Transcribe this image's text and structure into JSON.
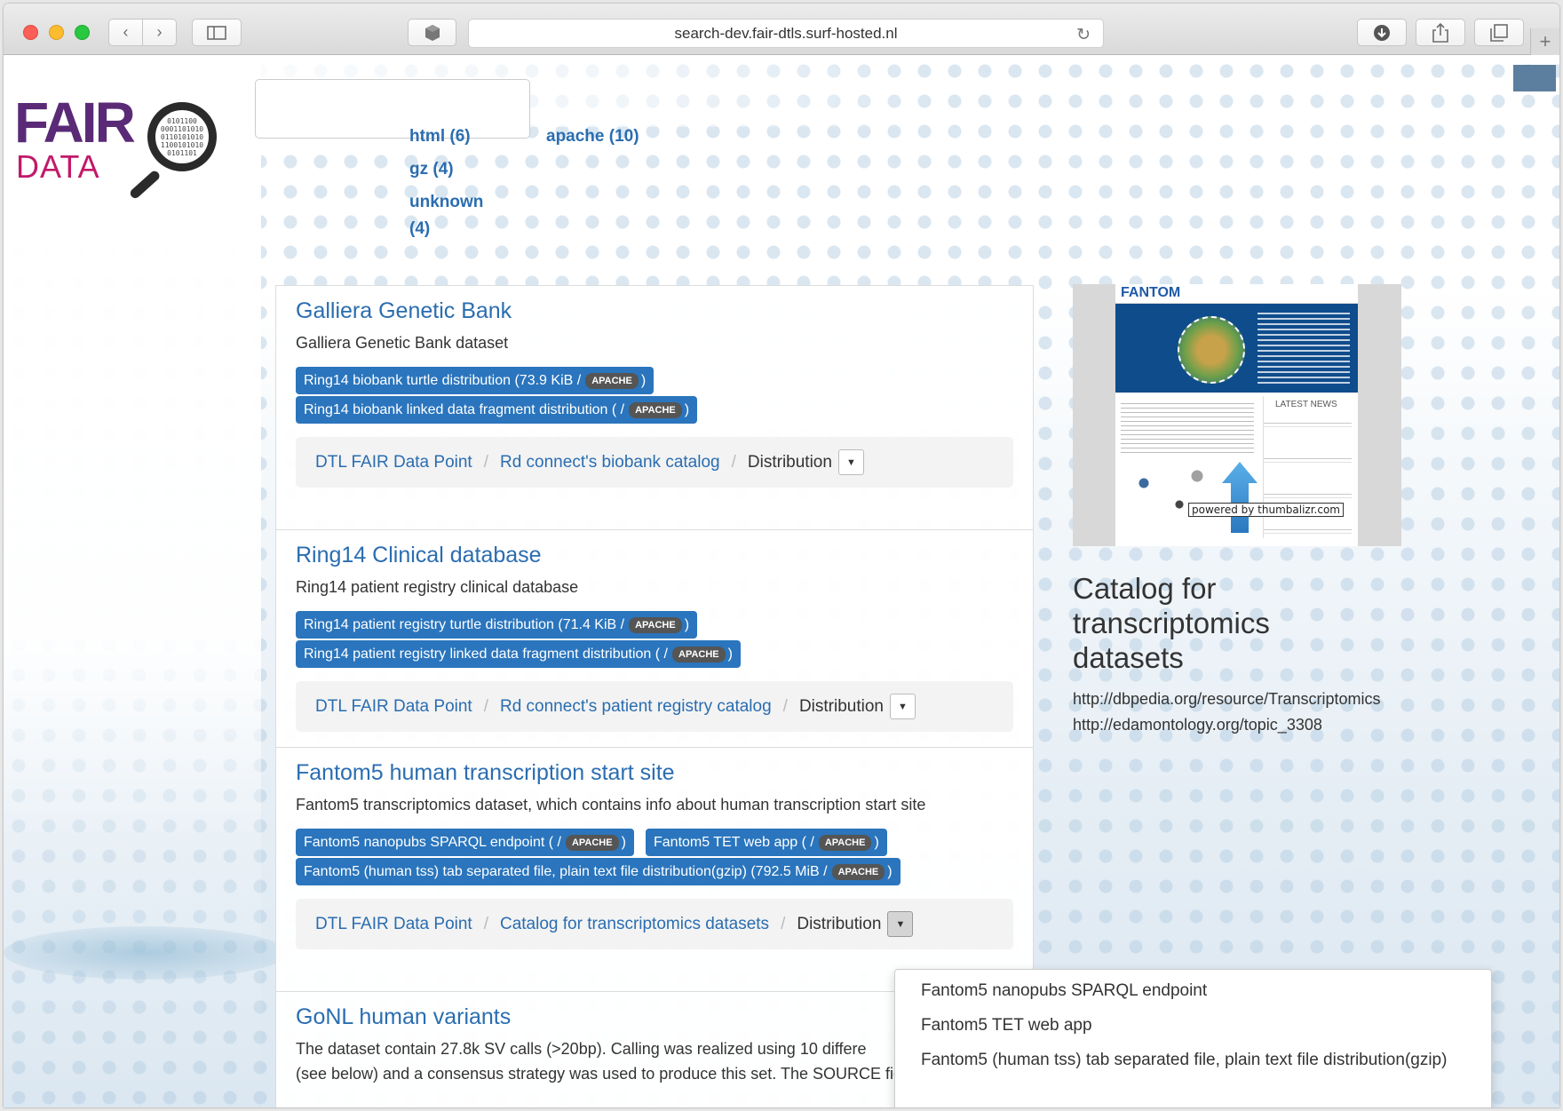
{
  "browser": {
    "url": "search-dev.fair-dtls.surf-hosted.nl"
  },
  "logo": {
    "fair": "FAIR",
    "data": "DATA",
    "lens_bits": "0101100\n0001101010\n0110101010\n1100101010\n0101101"
  },
  "search": {
    "value": "",
    "placeholder": ""
  },
  "facets": [
    {
      "label": "html (6)"
    },
    {
      "label": "apache (10)"
    },
    {
      "label": "gz (4)"
    },
    {
      "label": "unknown",
      "label2": "(4)"
    }
  ],
  "results": [
    {
      "title": "Galliera Genetic Bank",
      "description": "Galliera Genetic Bank dataset",
      "distributions": [
        {
          "label": "Ring14 biobank turtle distribution (73.9 KiB /",
          "license": "APACHE"
        },
        {
          "label": "Ring14 biobank linked data fragment distribution ( /",
          "license": "APACHE"
        }
      ],
      "breadcrumb": [
        "DTL FAIR Data Point",
        "Rd connect's biobank catalog",
        "Distribution"
      ]
    },
    {
      "title": "Ring14 Clinical database",
      "description": "Ring14 patient registry clinical database",
      "distributions": [
        {
          "label": "Ring14 patient registry turtle distribution (71.4 KiB /",
          "license": "APACHE"
        },
        {
          "label": "Ring14 patient registry linked data fragment distribution ( /",
          "license": "APACHE"
        }
      ],
      "breadcrumb": [
        "DTL FAIR Data Point",
        "Rd connect's patient registry catalog",
        "Distribution"
      ]
    },
    {
      "title": "Fantom5 human transcription start site",
      "description": "Fantom5 transcriptomics dataset, which contains info about human transcription start site",
      "distributions": [
        {
          "label": "Fantom5 nanopubs SPARQL endpoint ( /",
          "license": "APACHE"
        },
        {
          "label": "Fantom5 TET web app ( /",
          "license": "APACHE"
        },
        {
          "label": "Fantom5 (human tss) tab separated file, plain text file distribution(gzip) (792.5 MiB /",
          "license": "APACHE"
        }
      ],
      "breadcrumb": [
        "DTL FAIR Data Point",
        "Catalog for transcriptomics datasets",
        "Distribution"
      ]
    },
    {
      "title": "GoNL human variants",
      "description_line1": "The dataset contain 27.8k SV calls (>20bp). Calling was realized using 10 differe",
      "description_line2": "(see below) and a consensus strategy was used to produce this set. The SOURCE field in the"
    }
  ],
  "badge_close": ")",
  "dropdown": {
    "items": [
      "Fantom5 nanopubs SPARQL endpoint",
      "Fantom5 TET web app",
      "Fantom5 (human tss) tab separated file, plain text file distribution(gzip)"
    ]
  },
  "side_panel": {
    "preview_logo": "FANTOM",
    "preview_news": "LATEST NEWS",
    "powered_by": "powered by thumbalizr.com",
    "title": "Catalog for transcriptomics datasets",
    "uris": [
      "http://dbpedia.org/resource/Transcriptomics",
      "http://edamontology.org/topic_3308"
    ]
  },
  "colors": {
    "link": "#2a6db0",
    "badge": "#2a75bd",
    "license_badge": "#555555",
    "logo_purple": "#5a2a77",
    "logo_pink": "#c2196a"
  }
}
